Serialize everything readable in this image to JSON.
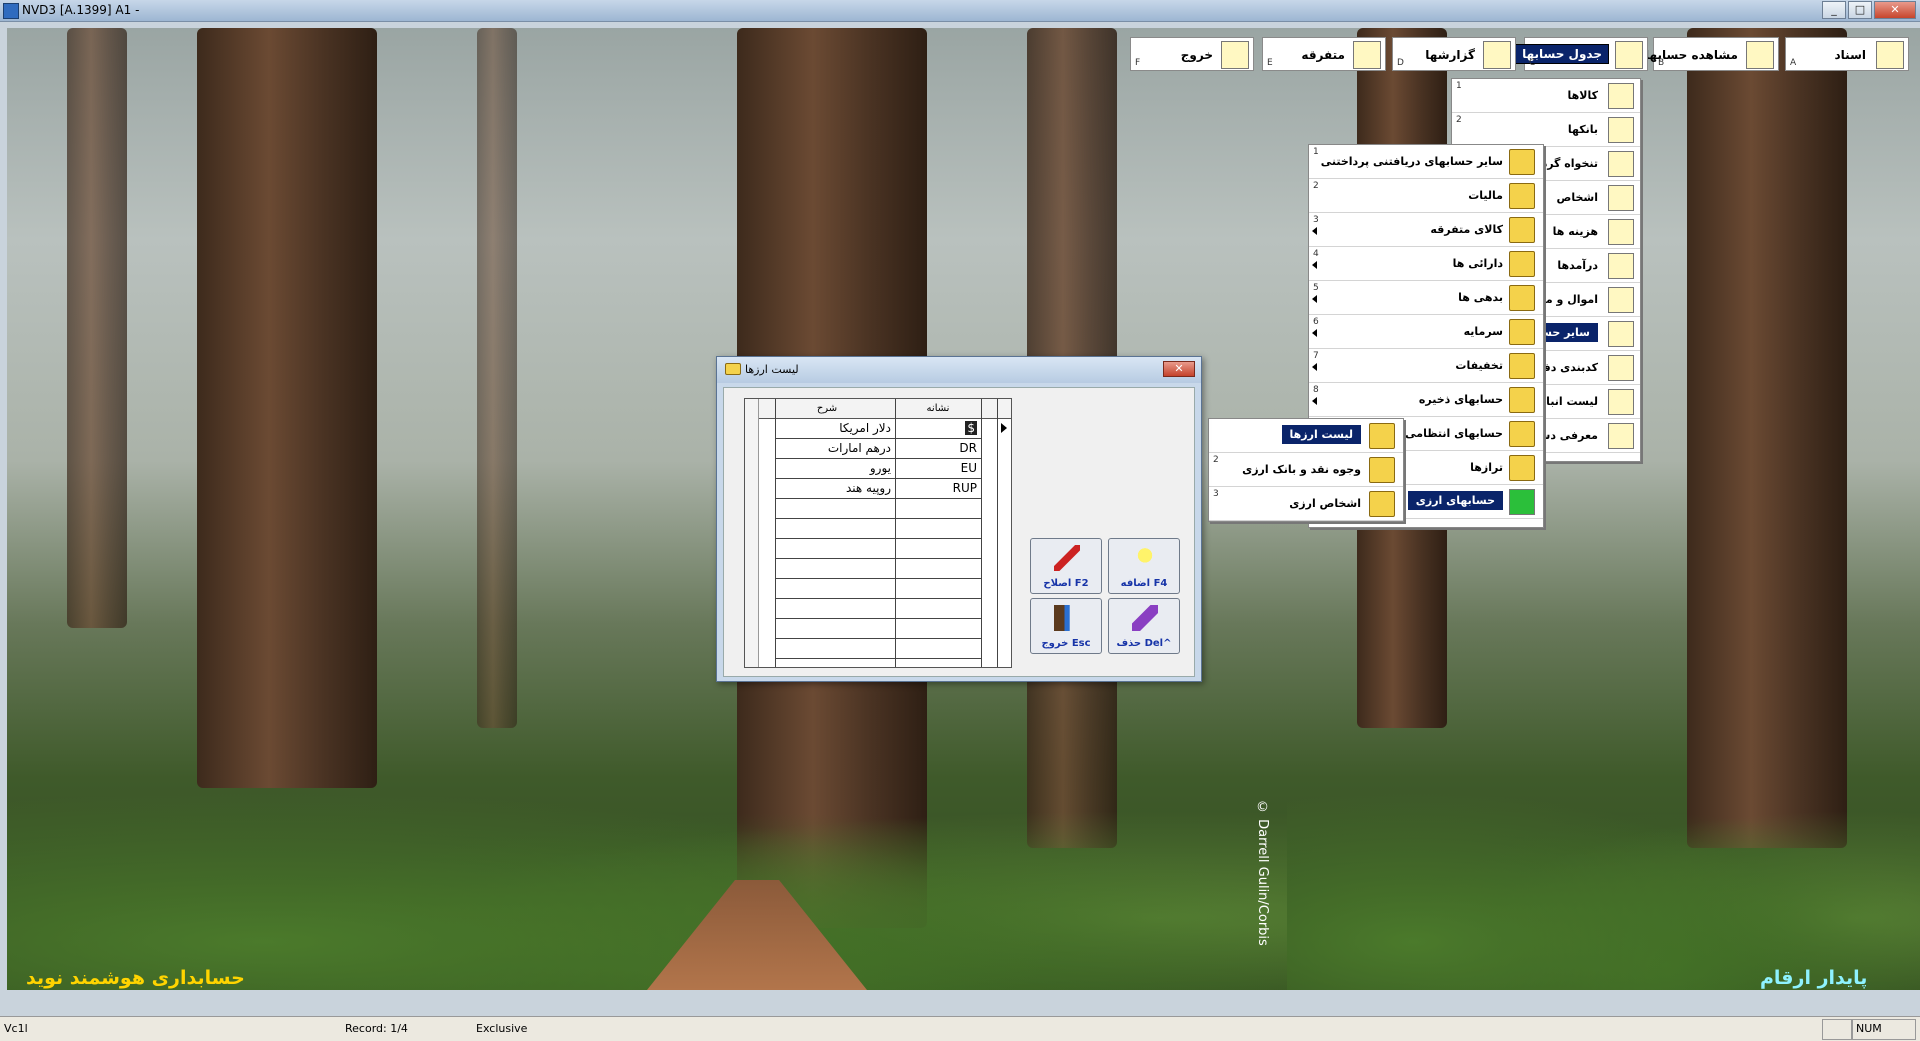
{
  "window": {
    "title": "NVD3 [A.1399] A1 -",
    "minimize": "_",
    "maximize": "□",
    "close": "✕"
  },
  "toolbar": [
    {
      "id": "asnad",
      "label": "اسناد",
      "key": "A",
      "icon": "document-pen-icon"
    },
    {
      "id": "moshahedeh",
      "label": "مشاهده حسابها",
      "key": "B",
      "icon": "document-view-icon"
    },
    {
      "id": "jadval",
      "label": "جدول حسابها",
      "key": "C",
      "icon": "folders-icon",
      "active": true
    },
    {
      "id": "gozaresh",
      "label": "گزارشها",
      "key": "D",
      "icon": "papers-icon"
    },
    {
      "id": "motefareghe",
      "label": "متفرقه",
      "key": "E",
      "icon": "tools-icon"
    },
    {
      "id": "khorooj",
      "label": "خروج",
      "key": "F",
      "icon": "exit-door-icon"
    }
  ],
  "menu_main": [
    {
      "num": "1",
      "label": "کالاها"
    },
    {
      "num": "2",
      "label": "بانکها"
    },
    {
      "num": "",
      "label": "تنخواه گردان"
    },
    {
      "num": "",
      "label": "اشخاص"
    },
    {
      "num": "",
      "label": "هزینه ها"
    },
    {
      "num": "",
      "label": "درآمدها"
    },
    {
      "num": "",
      "label": "اموال و ماشین آلات"
    },
    {
      "num": "",
      "label": "سایر حسابها",
      "selected": true
    },
    {
      "num": "",
      "label": "کدبندی دفاتر"
    },
    {
      "num": "",
      "label": "لیست انبارها"
    },
    {
      "num": "",
      "label": "معرفی دستگاهها"
    }
  ],
  "menu_sub": [
    {
      "num": "1",
      "label": "سایر حسابهای دریافتنی پرداختنی"
    },
    {
      "num": "2",
      "label": "مالیات"
    },
    {
      "num": "3",
      "label": "کالای متفرقه"
    },
    {
      "num": "4",
      "label": "دارائی ها"
    },
    {
      "num": "5",
      "label": "بدهی ها"
    },
    {
      "num": "6",
      "label": "سرمایه"
    },
    {
      "num": "7",
      "label": "تخفیفات"
    },
    {
      "num": "8",
      "label": "حسابهای ذخیره"
    },
    {
      "num": "",
      "label": "حسابهای انتظامی"
    },
    {
      "num": "",
      "label": "ترازها"
    },
    {
      "num": "",
      "label": "حسابهای ارزی",
      "selected": true
    }
  ],
  "menu_sub2": [
    {
      "num": "1",
      "label": "لیست ارزها",
      "selected": true
    },
    {
      "num": "2",
      "label": "وجوه نقد و بانک ارزی"
    },
    {
      "num": "3",
      "label": "اشخاص ارزی"
    }
  ],
  "dialog": {
    "title": "لیست ارزها",
    "close": "✕",
    "columns": {
      "code": "نشانه",
      "desc": "شرح"
    },
    "rows": [
      {
        "code": "$",
        "desc": "دلار امریکا"
      },
      {
        "code": "DR",
        "desc": "درهم امارات"
      },
      {
        "code": "EU",
        "desc": "یورو"
      },
      {
        "code": "RUP",
        "desc": "روپیه هند"
      }
    ],
    "buttons": {
      "add": "F4 اضافه",
      "edit": "F2 اصلاح",
      "delete": "^Del حذف",
      "exit": "Esc خروج"
    }
  },
  "brand_left": "حسابداری هوشمند نوید",
  "brand_right": "پایدار ارقام",
  "credit": "© Darrell Gulin/Corbis",
  "status": {
    "version": "Vc1l",
    "record": "Record: 1/4",
    "mode": "Exclusive",
    "num": "NUM"
  }
}
